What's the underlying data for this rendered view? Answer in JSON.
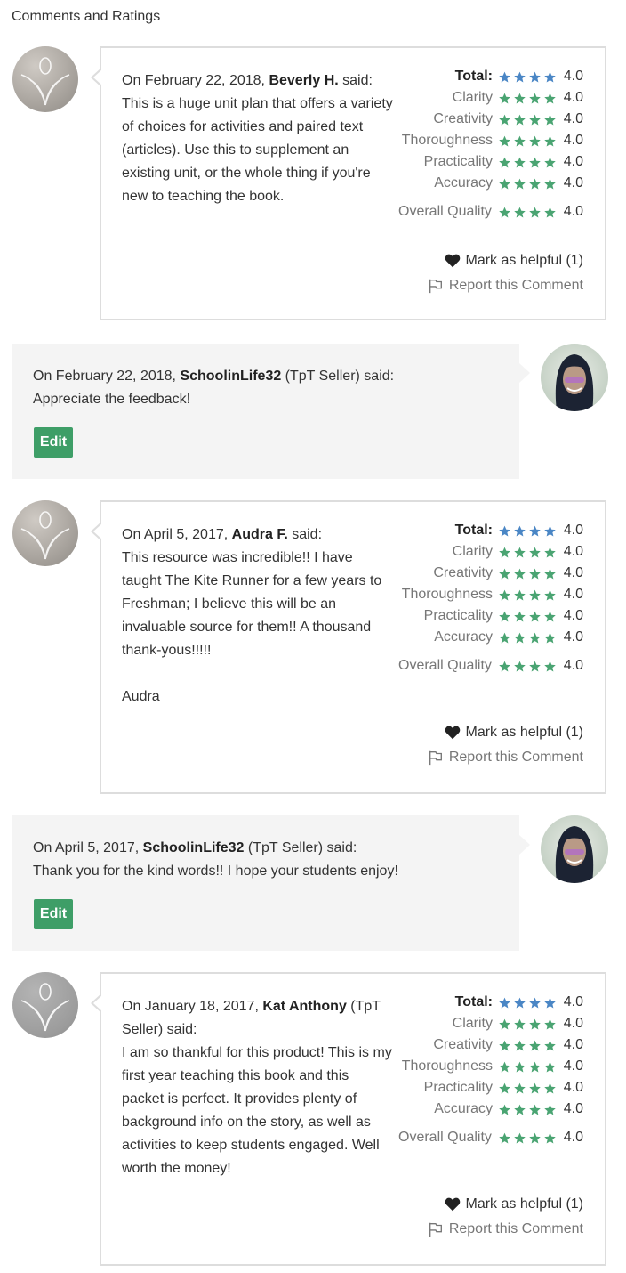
{
  "heading": "Comments and Ratings",
  "colors": {
    "total_star": "#4a86c5",
    "category_star": "#4aa472",
    "edit_button": "#3e9e67"
  },
  "labels": {
    "total": "Total:",
    "clarity": "Clarity",
    "creativity": "Creativity",
    "thoroughness": "Thoroughness",
    "practicality": "Practicality",
    "accuracy": "Accuracy",
    "overall_quality": "Overall Quality",
    "mark_helpful": "Mark as helpful (1)",
    "report": "Report this Comment",
    "edit": "Edit",
    "said": " said:",
    "seller_tag": " (TpT Seller)"
  },
  "reviews": [
    {
      "date_prefix": "On February 22, 2018, ",
      "author": "Beverly H.",
      "suffix": " said:",
      "body": "This is a huge unit plan that offers a variety of choices for activities and paired text (articles).  Use this to supplement an existing unit, or the whole thing if you're new to teaching the book.",
      "ratings": {
        "total": "4.0",
        "clarity": "4.0",
        "creativity": "4.0",
        "thoroughness": "4.0",
        "practicality": "4.0",
        "accuracy": "4.0",
        "overall_quality": "4.0"
      },
      "reply": {
        "date_prefix": "On February 22, 2018, ",
        "author": "SchoolinLife32",
        "suffix": " (TpT Seller) said:",
        "body": "Appreciate the feedback!"
      }
    },
    {
      "date_prefix": "On April 5, 2017, ",
      "author": "Audra F.",
      "suffix": " said:",
      "body": "This resource was incredible!!  I have taught The Kite Runner for a few years to Freshman; I believe this will be an invaluable source for them!!  A thousand thank-yous!!!!!\n\nAudra",
      "ratings": {
        "total": "4.0",
        "clarity": "4.0",
        "creativity": "4.0",
        "thoroughness": "4.0",
        "practicality": "4.0",
        "accuracy": "4.0",
        "overall_quality": "4.0"
      },
      "reply": {
        "date_prefix": "On April 5, 2017, ",
        "author": "SchoolinLife32",
        "suffix": " (TpT Seller) said:",
        "body": "Thank you for the kind words!! I hope your students enjoy!"
      }
    },
    {
      "date_prefix": "On January 18, 2017, ",
      "author": "Kat Anthony",
      "suffix": " (TpT Seller) said:",
      "body": "I am so thankful for this product! This is my first year teaching this book and this packet is perfect. It provides plenty of background info on the story, as well as activities to keep students engaged. Well worth the money!",
      "ratings": {
        "total": "4.0",
        "clarity": "4.0",
        "creativity": "4.0",
        "thoroughness": "4.0",
        "practicality": "4.0",
        "accuracy": "4.0",
        "overall_quality": "4.0"
      }
    }
  ]
}
